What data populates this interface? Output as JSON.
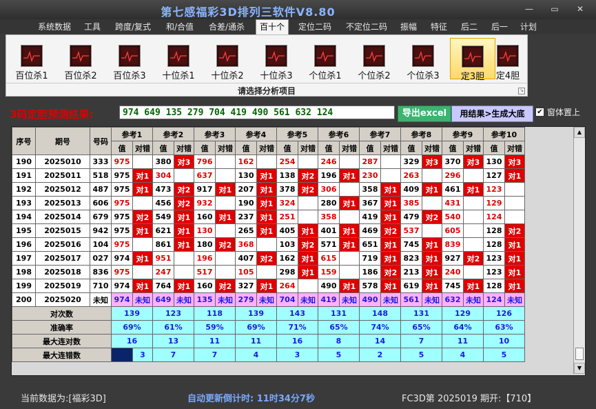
{
  "title": "第七感福彩3D排列三软件V8.80",
  "window_buttons": {
    "minimize": "—",
    "restore": "▭",
    "close": "✕"
  },
  "menu": [
    "系统数据",
    "工具",
    "跨度/复式",
    "和/合值",
    "合差/通杀",
    "百十个",
    "定位二码",
    "不定位二码",
    "振幅",
    "特征",
    "后二",
    "后一",
    "计划"
  ],
  "menu_active_index": 5,
  "ribbon": {
    "buttons": [
      "百位杀1",
      "百位杀2",
      "百位杀3",
      "十位杀1",
      "十位杀2",
      "十位杀3",
      "个位杀1",
      "个位杀2",
      "个位杀3",
      "定3胆",
      "定4胆"
    ],
    "active_index": 9,
    "icon": "chart-line-icon",
    "caption": "请选择分析项目"
  },
  "prediction": {
    "label": "3码定胆预测结果:",
    "value": "974 649 135 279 704 419 490 561 632 124",
    "excel_button": "导出excel",
    "big_button": "用结果>生成大底",
    "checkbox_checked": true,
    "checkbox_label": "窗体置上"
  },
  "table": {
    "headers": {
      "seq": "序号",
      "period": "期号",
      "code": "号码",
      "value": "值",
      "result": "对错"
    },
    "refs": [
      "参考1",
      "参考2",
      "参考3",
      "参考4",
      "参考5",
      "参考6",
      "参考7",
      "参考8",
      "参考9",
      "参考10"
    ],
    "rows": [
      {
        "seq": "190",
        "period": "2025010",
        "code": "333",
        "cells": [
          [
            "975",
            ""
          ],
          [
            "380",
            "对3"
          ],
          [
            "796",
            ""
          ],
          [
            "162",
            ""
          ],
          [
            "254",
            ""
          ],
          [
            "246",
            ""
          ],
          [
            "287",
            ""
          ],
          [
            "329",
            "对3"
          ],
          [
            "370",
            "对3"
          ],
          [
            "130",
            "对3"
          ]
        ]
      },
      {
        "seq": "191",
        "period": "2025011",
        "code": "518",
        "cells": [
          [
            "975",
            "对1"
          ],
          [
            "304",
            ""
          ],
          [
            "637",
            ""
          ],
          [
            "130",
            "对1"
          ],
          [
            "138",
            "对2"
          ],
          [
            "196",
            "对1"
          ],
          [
            "230",
            ""
          ],
          [
            "263",
            ""
          ],
          [
            "296",
            ""
          ],
          [
            "127",
            "对1"
          ]
        ]
      },
      {
        "seq": "192",
        "period": "2025012",
        "code": "487",
        "cells": [
          [
            "975",
            "对1"
          ],
          [
            "473",
            "对2"
          ],
          [
            "917",
            "对1"
          ],
          [
            "207",
            "对1"
          ],
          [
            "378",
            "对2"
          ],
          [
            "306",
            ""
          ],
          [
            "358",
            "对1"
          ],
          [
            "409",
            "对1"
          ],
          [
            "461",
            "对1"
          ],
          [
            "123",
            ""
          ]
        ]
      },
      {
        "seq": "193",
        "period": "2025013",
        "code": "606",
        "cells": [
          [
            "975",
            ""
          ],
          [
            "456",
            "对2"
          ],
          [
            "932",
            ""
          ],
          [
            "190",
            "对1"
          ],
          [
            "324",
            ""
          ],
          [
            "280",
            "对1"
          ],
          [
            "367",
            "对1"
          ],
          [
            "385",
            ""
          ],
          [
            "431",
            ""
          ],
          [
            "129",
            ""
          ]
        ]
      },
      {
        "seq": "194",
        "period": "2025014",
        "code": "679",
        "cells": [
          [
            "975",
            "对2"
          ],
          [
            "549",
            "对1"
          ],
          [
            "160",
            "对1"
          ],
          [
            "237",
            "对1"
          ],
          [
            "251",
            ""
          ],
          [
            "358",
            ""
          ],
          [
            "419",
            "对1"
          ],
          [
            "479",
            "对2"
          ],
          [
            "540",
            ""
          ],
          [
            "124",
            ""
          ]
        ]
      },
      {
        "seq": "195",
        "period": "2025015",
        "code": "942",
        "cells": [
          [
            "975",
            "对1"
          ],
          [
            "621",
            "对1"
          ],
          [
            "130",
            ""
          ],
          [
            "265",
            "对1"
          ],
          [
            "405",
            "对1"
          ],
          [
            "401",
            "对1"
          ],
          [
            "469",
            "对2"
          ],
          [
            "537",
            ""
          ],
          [
            "605",
            ""
          ],
          [
            "128",
            "对2"
          ]
        ]
      },
      {
        "seq": "196",
        "period": "2025016",
        "code": "104",
        "cells": [
          [
            "975",
            ""
          ],
          [
            "861",
            "对1"
          ],
          [
            "180",
            "对2"
          ],
          [
            "368",
            ""
          ],
          [
            "103",
            "对2"
          ],
          [
            "571",
            "对1"
          ],
          [
            "651",
            "对1"
          ],
          [
            "745",
            "对1"
          ],
          [
            "839",
            ""
          ],
          [
            "128",
            "对1"
          ]
        ]
      },
      {
        "seq": "197",
        "period": "2025017",
        "code": "027",
        "cells": [
          [
            "974",
            "对1"
          ],
          [
            "951",
            ""
          ],
          [
            "196",
            ""
          ],
          [
            "407",
            "对2"
          ],
          [
            "162",
            "对1"
          ],
          [
            "615",
            ""
          ],
          [
            "719",
            "对1"
          ],
          [
            "823",
            "对1"
          ],
          [
            "927",
            "对2"
          ],
          [
            "123",
            "对1"
          ]
        ]
      },
      {
        "seq": "198",
        "period": "2025018",
        "code": "836",
        "cells": [
          [
            "975",
            ""
          ],
          [
            "247",
            ""
          ],
          [
            "517",
            ""
          ],
          [
            "105",
            ""
          ],
          [
            "298",
            "对1"
          ],
          [
            "159",
            ""
          ],
          [
            "186",
            "对2"
          ],
          [
            "213",
            "对1"
          ],
          [
            "240",
            ""
          ],
          [
            "123",
            "对1"
          ]
        ]
      },
      {
        "seq": "199",
        "period": "2025019",
        "code": "710",
        "cells": [
          [
            "974",
            "对1"
          ],
          [
            "764",
            "对1"
          ],
          [
            "160",
            "对2"
          ],
          [
            "327",
            "对1"
          ],
          [
            "264",
            ""
          ],
          [
            "490",
            "对1"
          ],
          [
            "578",
            "对1"
          ],
          [
            "619",
            "对1"
          ],
          [
            "745",
            "对1"
          ],
          [
            "128",
            "对1"
          ]
        ]
      }
    ],
    "pending": {
      "seq": "200",
      "period": "2025020",
      "code": "未知",
      "values": [
        "974",
        "649",
        "135",
        "279",
        "704",
        "419",
        "490",
        "561",
        "632",
        "124"
      ],
      "result": "未知"
    },
    "stats": [
      {
        "label": "对次数",
        "values": [
          "139",
          "123",
          "118",
          "139",
          "143",
          "131",
          "148",
          "131",
          "129",
          "126"
        ]
      },
      {
        "label": "准确率",
        "values": [
          "69%",
          "61%",
          "59%",
          "69%",
          "71%",
          "65%",
          "74%",
          "65%",
          "64%",
          "63%"
        ]
      },
      {
        "label": "最大连对数",
        "values": [
          "16",
          "13",
          "11",
          "11",
          "16",
          "8",
          "14",
          "7",
          "11",
          "10"
        ]
      },
      {
        "label": "最大连错数",
        "values": [
          "3",
          "7",
          "7",
          "4",
          "3",
          "5",
          "2",
          "5",
          "4",
          "5"
        ]
      }
    ]
  },
  "status": {
    "current_data": "当前数据为:[福彩3D]",
    "countdown": "自动更新倒计时:  11时34分7秒",
    "latest": "FC3D第 2025019 期开:【710】"
  }
}
